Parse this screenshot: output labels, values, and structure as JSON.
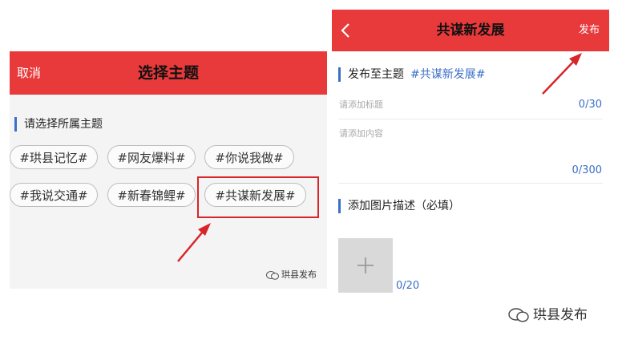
{
  "left": {
    "cancel_label": "取消",
    "title": "选择主题",
    "section_label": "请选择所属主题",
    "tags": [
      "#珙县记忆#",
      "#网友爆料#",
      "#你说我做#",
      "#我说交通#",
      "#新春锦鲤#",
      "#共谋新发展#"
    ],
    "watermark": "珙县发布"
  },
  "right": {
    "title": "共谋新发展",
    "publish_label": "发布",
    "topic_label": "发布至主题",
    "topic_value": "#共谋新发展#",
    "title_placeholder": "请添加标题",
    "title_count": "0/30",
    "content_placeholder": "请添加内容",
    "content_count": "0/300",
    "image_section_label": "添加图片描述（必填）",
    "image_count": "0/20"
  },
  "watermark": "珙县发布",
  "colors": {
    "header_red": "#e8393b",
    "accent_blue": "#3b6fc6",
    "highlight_red": "#d8252a"
  }
}
